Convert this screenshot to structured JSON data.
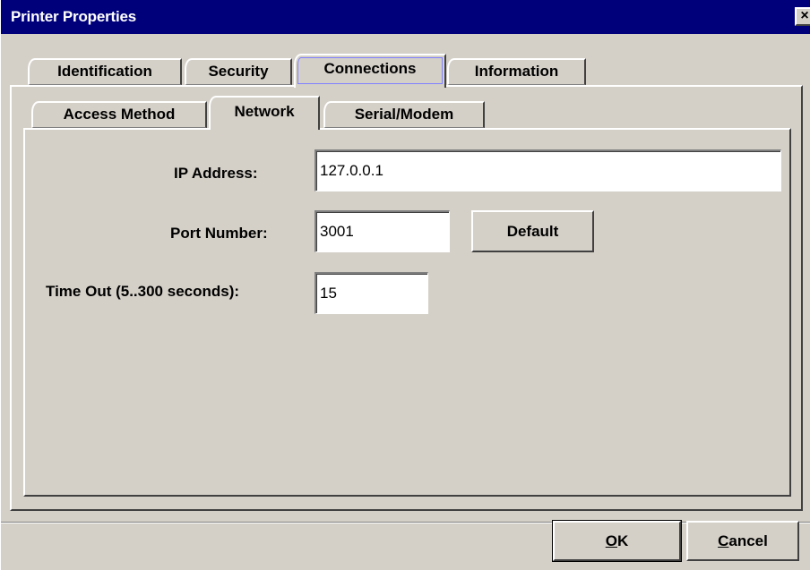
{
  "window": {
    "title": "Printer Properties",
    "close_glyph": "×"
  },
  "tabs": [
    {
      "label": "Identification",
      "active": false
    },
    {
      "label": "Security",
      "active": false
    },
    {
      "label": "Connections",
      "active": true
    },
    {
      "label": "Information",
      "active": false
    }
  ],
  "subtabs": [
    {
      "label": "Access Method",
      "active": false
    },
    {
      "label": "Network",
      "active": true
    },
    {
      "label": "Serial/Modem",
      "active": false
    }
  ],
  "form": {
    "ip_label": "IP Address:",
    "ip_value": "127.0.0.1",
    "port_label": "Port Number:",
    "port_value": "3001",
    "default_button": "Default",
    "timeout_label": "Time Out (5..300 seconds):",
    "timeout_value": "15"
  },
  "footer": {
    "ok_mnemonic": "O",
    "ok_rest": "K",
    "cancel_mnemonic": "C",
    "cancel_rest": "ancel"
  }
}
